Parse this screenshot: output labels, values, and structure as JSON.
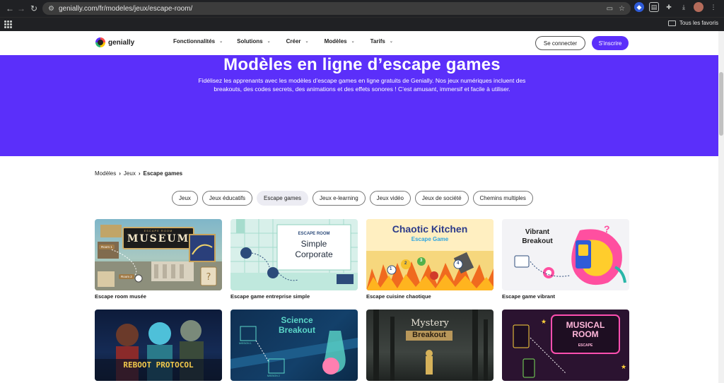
{
  "browser": {
    "url": "genially.com/fr/modeles/jeux/escape-room/",
    "bookmarks_label": "Tous les favoris"
  },
  "site": {
    "logo_text": "genially",
    "nav": [
      "Fonctionnalités",
      "Solutions",
      "Créer",
      "Modèles",
      "Tarifs"
    ],
    "login": "Se connecter",
    "signup": "S'inscrire"
  },
  "hero": {
    "title": "Modèles en ligne d’escape games",
    "description": "Fidélisez les apprenants avec les modèles d’escape games en ligne gratuits de Genially. Nos jeux numériques incluent des breakouts, des codes secrets, des animations et des effets sonores ! C’est amusant, immersif et facile à utiliser."
  },
  "breadcrumb": [
    "Modèles",
    "Jeux",
    "Escape games"
  ],
  "filters": [
    {
      "label": "Jeux",
      "active": false
    },
    {
      "label": "Jeux éducatifs",
      "active": false
    },
    {
      "label": "Escape games",
      "active": true
    },
    {
      "label": "Jeux e-learning",
      "active": false
    },
    {
      "label": "Jeux vidéo",
      "active": false
    },
    {
      "label": "Jeux de société",
      "active": false
    },
    {
      "label": "Chemins multiples",
      "active": false
    }
  ],
  "cards": [
    {
      "title": "Escape room musée",
      "thumb_text": "MUSEUM",
      "thumb_sub": "ESCAPE ROOM",
      "labels": [
        "Room 1",
        "Room 2"
      ]
    },
    {
      "title": "Escape game entreprise simple",
      "thumb_text": "Simple Corporate",
      "thumb_sub": "ESCAPE ROOM"
    },
    {
      "title": "Escape cuisine chaotique",
      "thumb_text": "Chaotic Kitchen",
      "thumb_sub": "Escape Game",
      "labels": [
        "1",
        "2",
        "3",
        "4"
      ]
    },
    {
      "title": "Escape game vibrant",
      "thumb_text": "Vibrant Breakout"
    },
    {
      "title": "",
      "thumb_text": "REBOOT PROTOCOL"
    },
    {
      "title": "",
      "thumb_text": "Science Breakout",
      "labels": [
        "MISSION 1",
        "MISSION 2"
      ]
    },
    {
      "title": "",
      "thumb_text": "Mystery",
      "thumb_sub": "Breakout"
    },
    {
      "title": "",
      "thumb_text": "MUSICAL ROOM",
      "thumb_sub": "ESCAPE"
    }
  ],
  "colors": {
    "brand_purple": "#5b2ffa",
    "chrome_dark": "#202124"
  }
}
